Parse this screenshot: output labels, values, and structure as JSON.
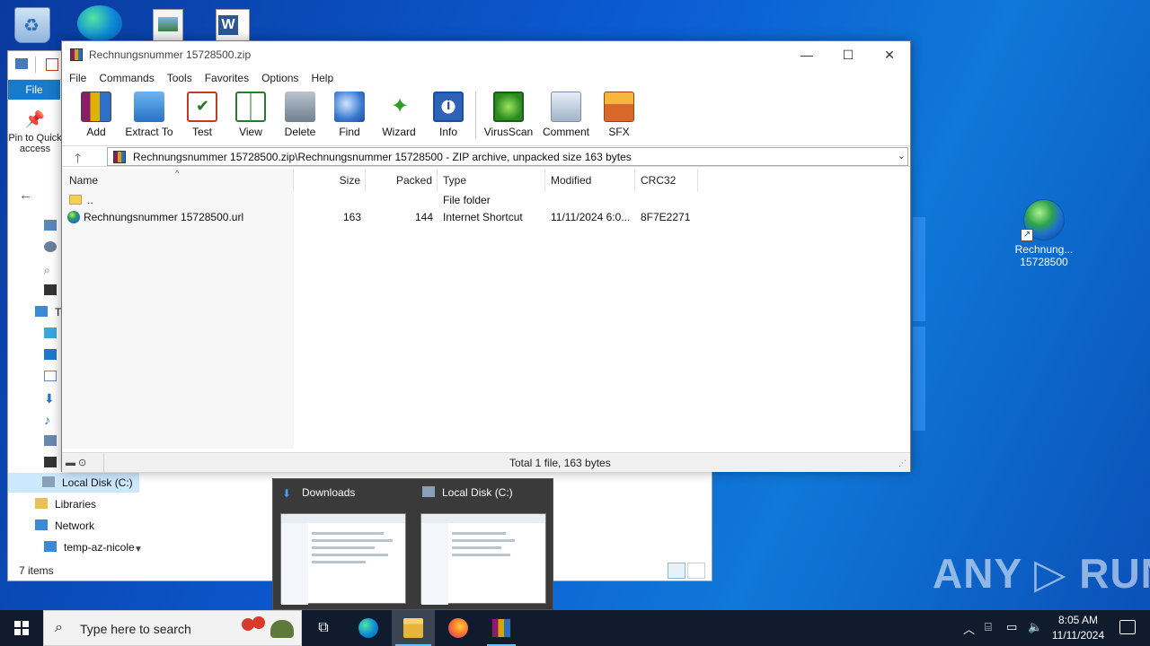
{
  "desktop": {
    "icons": [
      {
        "name": "recycle-bin"
      },
      {
        "name": "edge"
      },
      {
        "name": "image-file"
      },
      {
        "name": "word-doc"
      }
    ],
    "shortcut_label_line1": "Rechnung...",
    "shortcut_label_line2": "15728500",
    "watermark": "ANY ▷ RUN"
  },
  "explorer": {
    "file_tab": "File",
    "pin_label": "Pin to Quick access",
    "sidebar": {
      "selected": "Local Disk (C:)",
      "items": [
        "Libraries",
        "Network",
        "temp-az-nicole"
      ],
      "partial_label": "T"
    },
    "status": "7 items"
  },
  "winrar": {
    "title": "Rechnungsnummer 15728500.zip",
    "menu": [
      "File",
      "Commands",
      "Tools",
      "Favorites",
      "Options",
      "Help"
    ],
    "toolbar": [
      {
        "label": "Add",
        "icon": "add-archive-icon"
      },
      {
        "label": "Extract To",
        "icon": "extract-folder-icon"
      },
      {
        "label": "Test",
        "icon": "test-clipboard-icon"
      },
      {
        "label": "View",
        "icon": "view-book-icon"
      },
      {
        "label": "Delete",
        "icon": "trash-icon"
      },
      {
        "label": "Find",
        "icon": "magnifier-icon"
      },
      {
        "label": "Wizard",
        "icon": "wand-icon"
      },
      {
        "label": "Info",
        "icon": "info-icon"
      },
      {
        "label": "VirusScan",
        "icon": "bug-scan-icon"
      },
      {
        "label": "Comment",
        "icon": "comment-icon"
      },
      {
        "label": "SFX",
        "icon": "sfx-box-icon"
      }
    ],
    "address": "Rechnungsnummer 15728500.zip\\Rechnungsnummer 15728500 - ZIP archive, unpacked size 163 bytes",
    "columns": [
      "Name",
      "Size",
      "Packed",
      "Type",
      "Modified",
      "CRC32"
    ],
    "rows": [
      {
        "name": "..",
        "size": "",
        "packed": "",
        "type": "File folder",
        "modified": "",
        "crc": ""
      },
      {
        "name": "Rechnungsnummer 15728500.url",
        "size": "163",
        "packed": "144",
        "type": "Internet Shortcut",
        "modified": "11/11/2024 6:0...",
        "crc": "8F7E2271"
      }
    ],
    "status": "Total 1 file, 163 bytes"
  },
  "thumbnails": [
    {
      "label": "Downloads"
    },
    {
      "label": "Local Disk (C:)"
    }
  ],
  "taskbar": {
    "search_placeholder": "Type here to search",
    "clock_time": "8:05 AM",
    "clock_date": "11/11/2024"
  }
}
